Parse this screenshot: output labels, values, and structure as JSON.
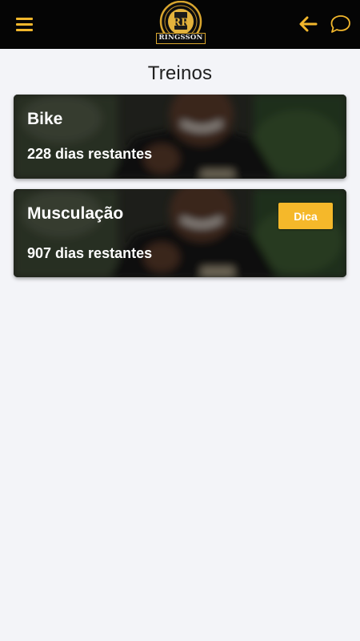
{
  "header": {
    "logo_text": "RINGSSON",
    "logo_initials": "RR",
    "menu_icon": "hamburger-menu-icon",
    "back_icon": "arrow-left-icon",
    "chat_icon": "chat-bubble-icon",
    "accent_color": "#f2b72c",
    "background_color": "#050505"
  },
  "page": {
    "title": "Treinos"
  },
  "cards": [
    {
      "title": "Bike",
      "subtitle": "228 dias restantes"
    },
    {
      "title": "Musculação",
      "subtitle": "907 dias restantes",
      "button_label": "Dica",
      "button_color": "#f5b82a"
    }
  ]
}
